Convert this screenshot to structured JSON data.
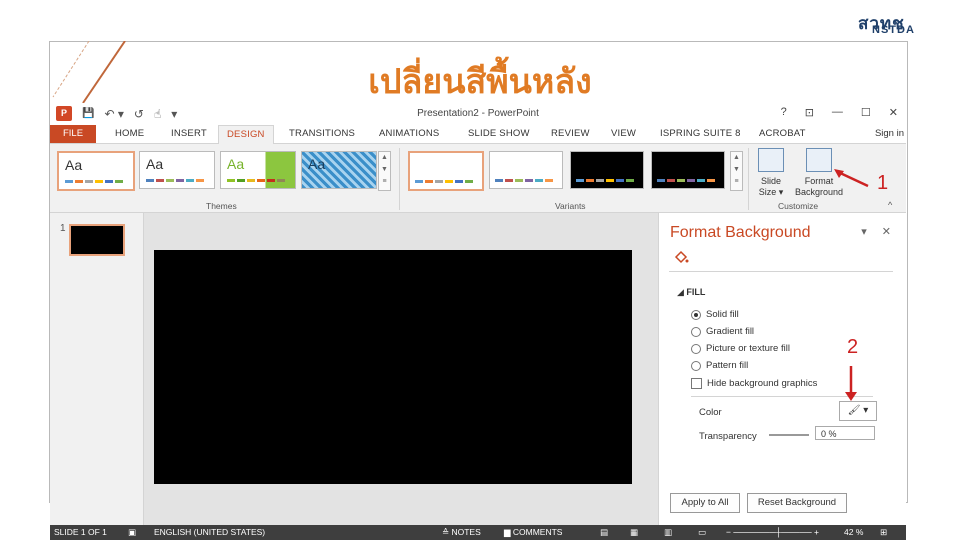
{
  "slide_title": "เปลี่ยนสีพื้นหลัง",
  "logo": {
    "line1": "สวทช",
    "line2": "NSTDA"
  },
  "ppt_window": {
    "title": "Presentation2 - PowerPoint",
    "help": "?",
    "controls": [
      "⊡",
      "—",
      "☐",
      "✕"
    ],
    "qat": {
      "app_icon": "P",
      "save": "💾",
      "undo": "↶ ▾",
      "redo": "↺",
      "touch": "☝",
      "more": "▾"
    }
  },
  "tabs": {
    "file": "FILE",
    "home": "HOME",
    "insert": "INSERT",
    "design": "DESIGN",
    "transitions": "TRANSITIONS",
    "animations": "ANIMATIONS",
    "slide_show": "SLIDE SHOW",
    "review": "REVIEW",
    "view": "VIEW",
    "ispring": "ISPRING SUITE 8",
    "acrobat": "ACROBAT",
    "sign_in": "Sign in"
  },
  "ribbon": {
    "themes_label": "Themes",
    "variants_label": "Variants",
    "customize_label": "Customize",
    "theme_aa": "Aa",
    "slide_size": "Slide\nSize ▾",
    "format_background": "Format\nBackground",
    "collapse": "^"
  },
  "annotations": {
    "one": "1",
    "two": "2"
  },
  "thumbnail": {
    "number": "1"
  },
  "format_pane": {
    "title": "Format Background",
    "controls": "▾ ✕",
    "fill_header": "◢  FILL",
    "options": [
      {
        "label": "Solid fill",
        "selected": true
      },
      {
        "label": "Gradient fill",
        "selected": false
      },
      {
        "label": "Picture or texture fill",
        "selected": false
      },
      {
        "label": "Pattern fill",
        "selected": false
      }
    ],
    "hide_bg": "Hide background graphics",
    "color_label": "Color",
    "color_value": "🖌 ▾",
    "transparency_label": "Transparency",
    "transparency_value": "0 %",
    "apply_all": "Apply to All",
    "reset": "Reset Background"
  },
  "status": {
    "slide": "SLIDE 1 OF 1",
    "language": "ENGLISH (UNITED STATES)",
    "notes": "≙ NOTES",
    "comments": "▆ COMMENTS",
    "zoom": "42 %"
  },
  "colors": {
    "accent": "#c94924",
    "title_orange": "#e07b24",
    "annot_red": "#cc2222"
  }
}
